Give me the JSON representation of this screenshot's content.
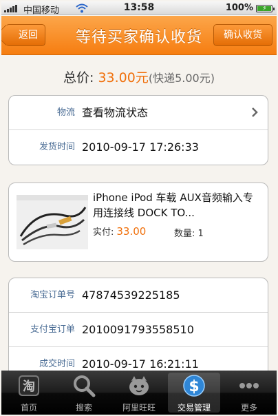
{
  "status_bar": {
    "carrier": "中国移动",
    "time": "13:58",
    "battery": "100%"
  },
  "navbar": {
    "back": "返回",
    "title": "等待买家确认收货",
    "confirm": "确认收货"
  },
  "summary": {
    "total_label": "总价: ",
    "total_value": "33.00元",
    "shipping": "(快递5.00元)"
  },
  "logistics": {
    "rows": [
      {
        "label": "物流",
        "value": "查看物流状态"
      },
      {
        "label": "发货时间",
        "value": "2010-09-17 17:26:33"
      }
    ]
  },
  "product": {
    "title": "iPhone iPod 车载 AUX音频输入专用连接线 DOCK TO...",
    "price_label": "实付:",
    "price": "33.00",
    "qty_label": "数量: 1"
  },
  "order": {
    "rows": [
      {
        "label": "淘宝订单号",
        "value": "47874539225185"
      },
      {
        "label": "支付宝订单",
        "value": "2010091793558510"
      },
      {
        "label": "成交时间",
        "value": "2010-09-17 16:21:11"
      }
    ]
  },
  "tabbar": {
    "items": [
      {
        "label": "首页",
        "icon": "taobao-logo-icon"
      },
      {
        "label": "搜索",
        "icon": "search-icon"
      },
      {
        "label": "阿里旺旺",
        "icon": "wangwang-icon"
      },
      {
        "label": "交易管理",
        "icon": "dollar-icon"
      },
      {
        "label": "更多",
        "icon": "more-dots-icon"
      }
    ],
    "active_index": 3
  },
  "colors": {
    "accent": "#f67d10",
    "price": "#f0700c",
    "label": "#4b6d95"
  }
}
